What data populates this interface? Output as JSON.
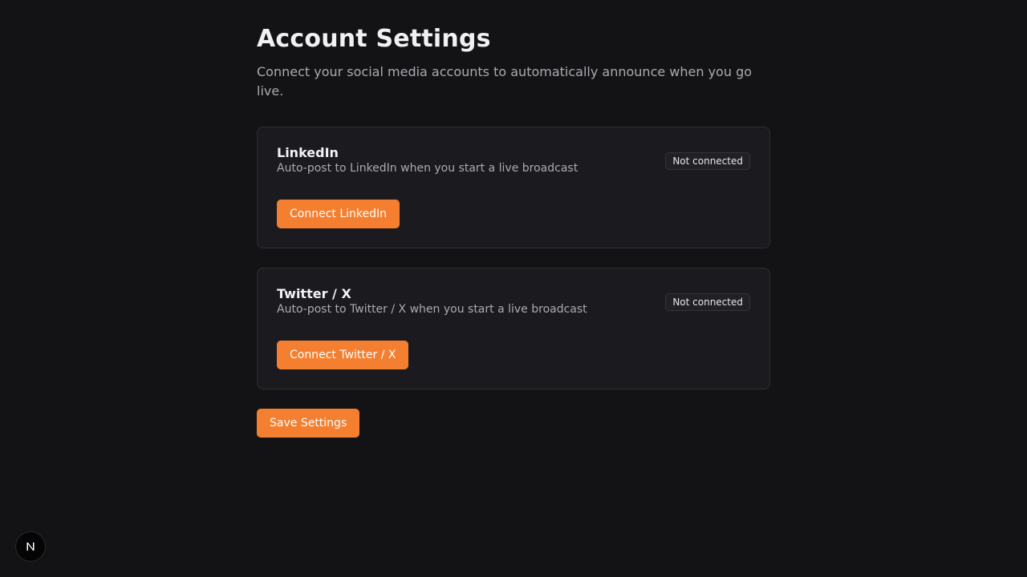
{
  "header": {
    "title": "Account Settings",
    "subtitle": "Connect your social media accounts to automatically announce when you go live."
  },
  "accounts": [
    {
      "title": "LinkedIn",
      "description": "Auto-post to LinkedIn when you start a live broadcast",
      "status": "Not connected",
      "button_label": "Connect LinkedIn"
    },
    {
      "title": "Twitter / X",
      "description": "Auto-post to Twitter / X when you start a live broadcast",
      "status": "Not connected",
      "button_label": "Connect Twitter / X"
    }
  ],
  "actions": {
    "save_label": "Save Settings"
  },
  "theme": {
    "background": "#131316",
    "card_background": "#1b1b1f",
    "accent": "#f47f30"
  },
  "icons": {
    "dev_indicator": "nextjs-logo-icon"
  }
}
